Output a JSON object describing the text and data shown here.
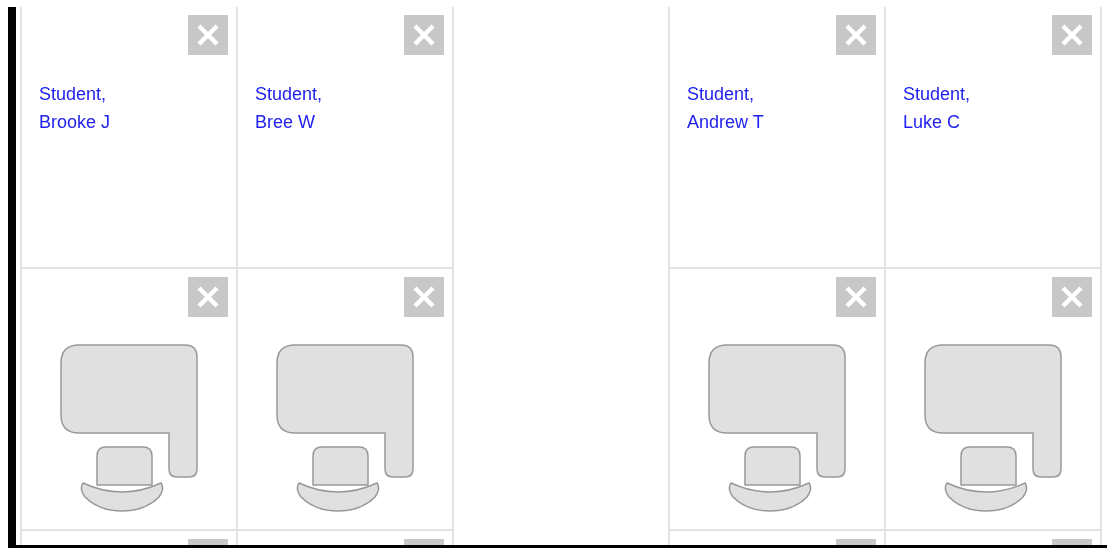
{
  "rows": [
    {
      "left": [
        {
          "kind": "student",
          "name": "Student,\nBrooke J"
        },
        {
          "kind": "student",
          "name": "Student,\nBree W"
        }
      ],
      "right": [
        {
          "kind": "student",
          "name": "Student,\nAndrew T"
        },
        {
          "kind": "student",
          "name": "Student,\nLuke C"
        }
      ]
    },
    {
      "left": [
        {
          "kind": "desk"
        },
        {
          "kind": "desk"
        }
      ],
      "right": [
        {
          "kind": "desk"
        },
        {
          "kind": "desk"
        }
      ]
    },
    {
      "left": [
        {
          "kind": "stub"
        },
        {
          "kind": "stub"
        }
      ],
      "right": [
        {
          "kind": "stub"
        },
        {
          "kind": "stub"
        }
      ]
    }
  ]
}
